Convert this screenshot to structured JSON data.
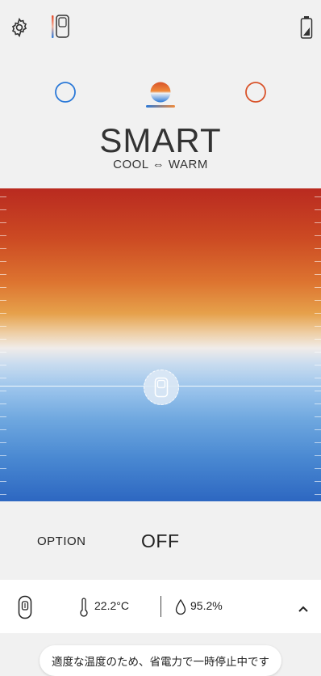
{
  "header": {
    "settings_icon": "gear-icon",
    "device_icon": "device-remote-icon",
    "battery_icon": "battery-icon"
  },
  "modes": [
    {
      "name": "cool",
      "color": "#2b79d8"
    },
    {
      "name": "smart",
      "colors": [
        "#2b79d8",
        "#f08a3a"
      ]
    },
    {
      "name": "warm",
      "color": "#d9532a"
    }
  ],
  "mode": {
    "title": "SMART",
    "subtitle": "COOL ⇔ WARM"
  },
  "notice": "適度な温度のため、省電力で一時停止中です",
  "option": {
    "label": "OPTION",
    "value": "OFF"
  },
  "status": {
    "temperature": "22.2°C",
    "humidity": "95.2%"
  }
}
